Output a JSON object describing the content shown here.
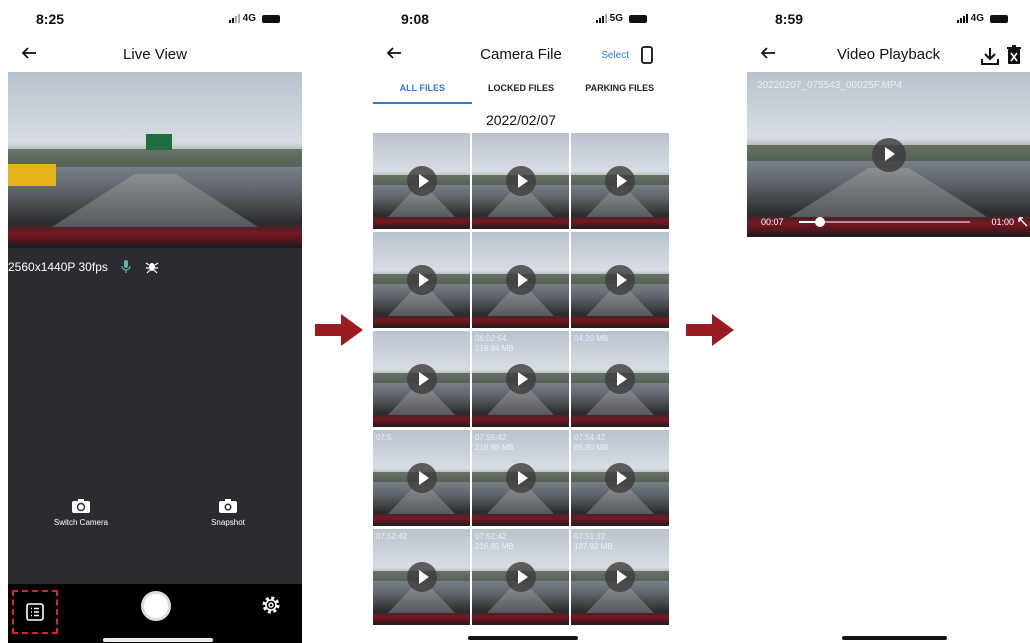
{
  "colors": {
    "accent": "#2f7dd6",
    "arrow": "#9b1b22",
    "highlight": "#d6252c",
    "dark_panel": "#2b2c30"
  },
  "live_view": {
    "status": {
      "time": "8:25",
      "network": "4G"
    },
    "title": "Live View",
    "resolution": "2560x1440P 30fps",
    "switch_camera_label": "Switch Camera",
    "snapshot_label": "Snapshot",
    "icons": [
      "back-arrow-icon",
      "mic-icon",
      "bug-icon",
      "switch-camera-icon",
      "camera-icon",
      "file-list-icon",
      "record-icon",
      "gear-icon"
    ]
  },
  "camera_file": {
    "status": {
      "time": "9:08",
      "network": "5G"
    },
    "title": "Camera File",
    "select_label": "Select",
    "tabs": [
      {
        "label": "ALL FILES",
        "active": true
      },
      {
        "label": "LOCKED FILES",
        "active": false
      },
      {
        "label": "PARKING FILES",
        "active": false
      }
    ],
    "date_header": "2022/02/07",
    "thumbnails": [
      {
        "text": ""
      },
      {
        "text": ""
      },
      {
        "text": ""
      },
      {
        "text": ""
      },
      {
        "text": ""
      },
      {
        "text": ""
      },
      {
        "text": ""
      },
      {
        "text": "06:02:54\n216.84 MB"
      },
      {
        "text": "04:20 MB"
      },
      {
        "text": "07:5"
      },
      {
        "text": "07:55:42\n216.88 MB"
      },
      {
        "text": "07:54:42\n85.90 MB"
      },
      {
        "text": "07:52:42"
      },
      {
        "text": "07:52:42\n216.85 MB"
      },
      {
        "text": "07:51:32\n187.92 MB"
      }
    ]
  },
  "video_playback": {
    "status": {
      "time": "8:59",
      "network": "4G"
    },
    "title": "Video Playback",
    "filename": "20220207_075543_00025F.MP4",
    "current_time": "00:07",
    "duration": "01:00",
    "progress": 0.12
  }
}
